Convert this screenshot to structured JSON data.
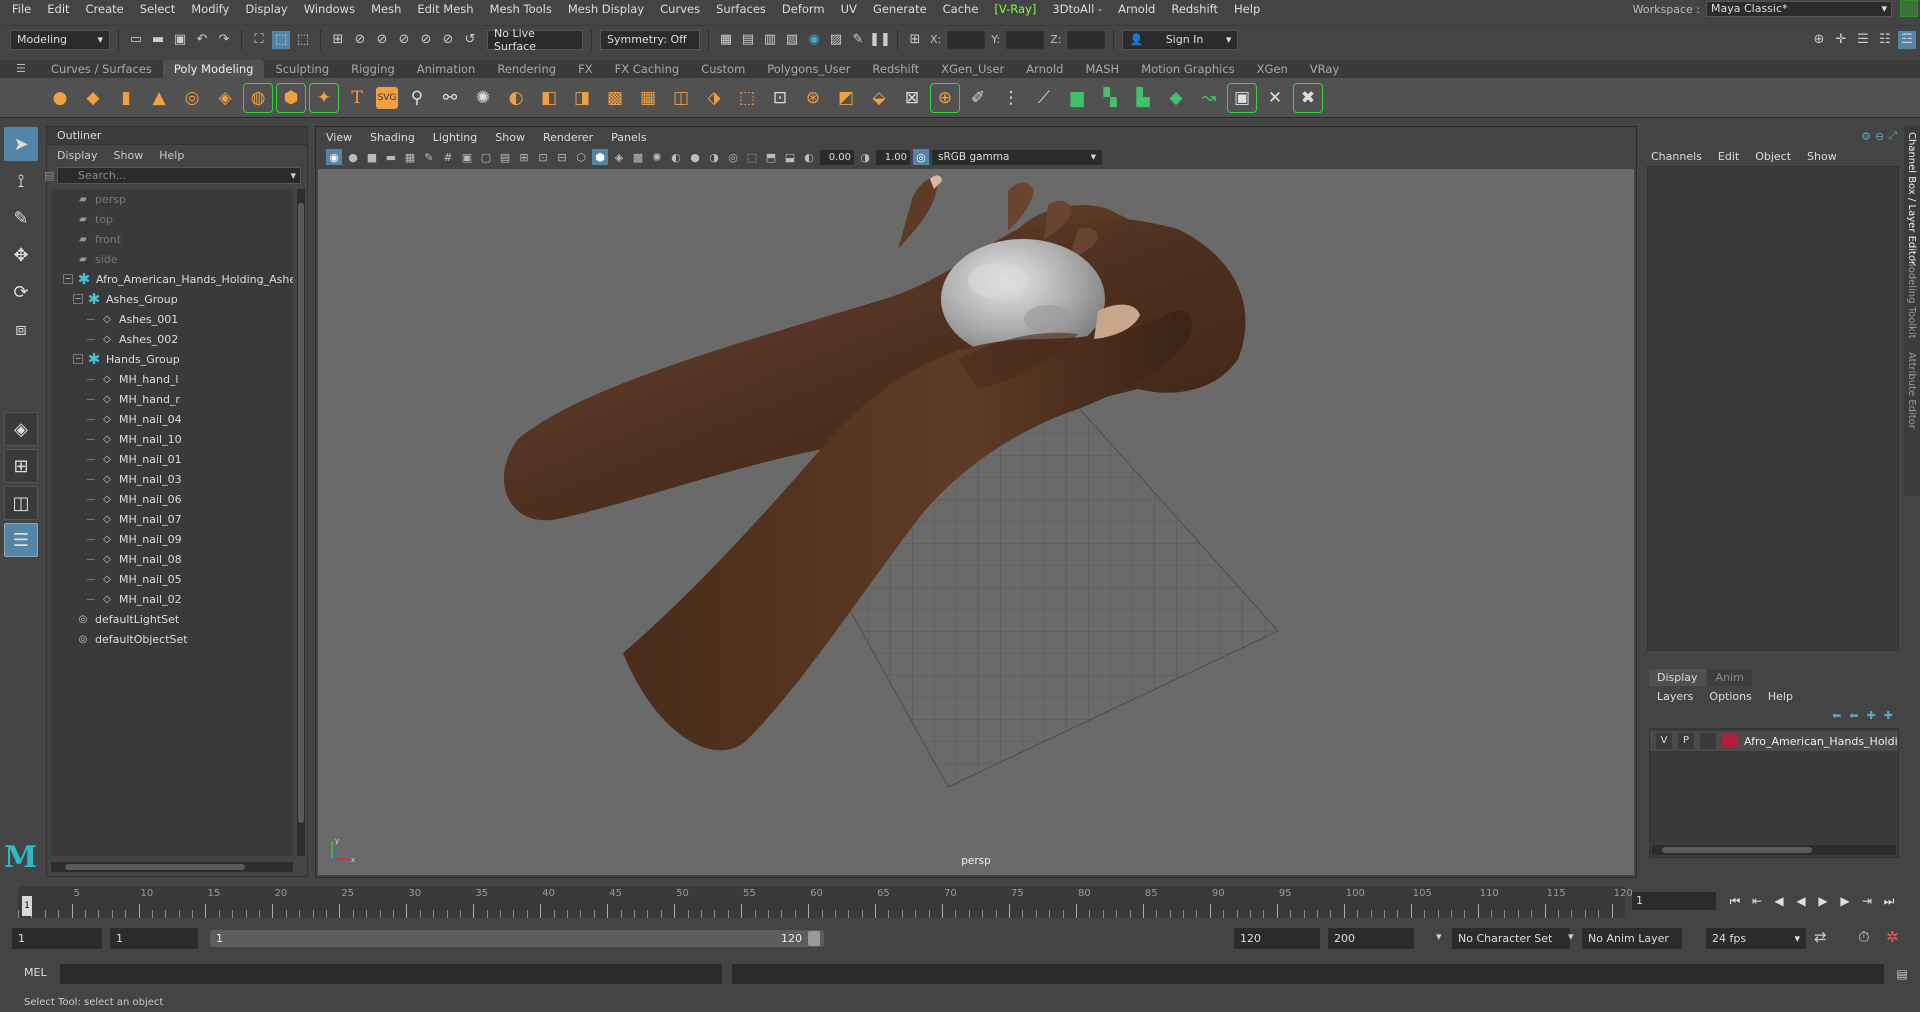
{
  "menubar": {
    "items": [
      "File",
      "Edit",
      "Create",
      "Select",
      "Modify",
      "Display",
      "Windows",
      "Mesh",
      "Edit Mesh",
      "Mesh Tools",
      "Mesh Display",
      "Curves",
      "Surfaces",
      "Deform",
      "UV",
      "Generate",
      "Cache",
      "[V-Ray]",
      "3DtoAll -",
      "Arnold",
      "Redshift",
      "Help"
    ],
    "workspace_label": "Workspace :",
    "workspace_value": "Maya Classic*"
  },
  "statusline": {
    "mode": "Modeling",
    "live_surface": "No Live Surface",
    "symmetry": "Symmetry: Off",
    "x_label": "X:",
    "y_label": "Y:",
    "z_label": "Z:",
    "sign_in": "Sign In"
  },
  "shelf": {
    "tabs": [
      "Curves / Surfaces",
      "Poly Modeling",
      "Sculpting",
      "Rigging",
      "Animation",
      "Rendering",
      "FX",
      "FX Caching",
      "Custom",
      "Polygons_User",
      "Redshift",
      "XGen_User",
      "Arnold",
      "MASH",
      "Motion Graphics",
      "XGen",
      "VRay"
    ],
    "active_tab": "Poly Modeling",
    "type_tool": "T",
    "svg_tool": "SVG"
  },
  "outliner": {
    "title": "Outliner",
    "menu": [
      "Display",
      "Show",
      "Help"
    ],
    "search_placeholder": "Search...",
    "items": [
      {
        "name": "persp",
        "kind": "camera",
        "depth": 0,
        "dim": true
      },
      {
        "name": "top",
        "kind": "camera",
        "depth": 0,
        "dim": true
      },
      {
        "name": "front",
        "kind": "camera",
        "depth": 0,
        "dim": true
      },
      {
        "name": "side",
        "kind": "camera",
        "depth": 0,
        "dim": true
      },
      {
        "name": "Afro_American_Hands_Holding_Ashe",
        "kind": "group",
        "depth": 0,
        "expander": "-"
      },
      {
        "name": "Ashes_Group",
        "kind": "group",
        "depth": 1,
        "expander": "-"
      },
      {
        "name": "Ashes_001",
        "kind": "mesh",
        "depth": 2
      },
      {
        "name": "Ashes_002",
        "kind": "mesh",
        "depth": 2
      },
      {
        "name": "Hands_Group",
        "kind": "group",
        "depth": 1,
        "expander": "-"
      },
      {
        "name": "MH_hand_l",
        "kind": "mesh",
        "depth": 2
      },
      {
        "name": "MH_hand_r",
        "kind": "mesh",
        "depth": 2
      },
      {
        "name": "MH_nail_04",
        "kind": "mesh",
        "depth": 2
      },
      {
        "name": "MH_nail_10",
        "kind": "mesh",
        "depth": 2
      },
      {
        "name": "MH_nail_01",
        "kind": "mesh",
        "depth": 2
      },
      {
        "name": "MH_nail_03",
        "kind": "mesh",
        "depth": 2
      },
      {
        "name": "MH_nail_06",
        "kind": "mesh",
        "depth": 2
      },
      {
        "name": "MH_nail_07",
        "kind": "mesh",
        "depth": 2
      },
      {
        "name": "MH_nail_09",
        "kind": "mesh",
        "depth": 2
      },
      {
        "name": "MH_nail_08",
        "kind": "mesh",
        "depth": 2
      },
      {
        "name": "MH_nail_05",
        "kind": "mesh",
        "depth": 2
      },
      {
        "name": "MH_nail_02",
        "kind": "mesh",
        "depth": 2
      },
      {
        "name": "defaultLightSet",
        "kind": "set",
        "depth": 0
      },
      {
        "name": "defaultObjectSet",
        "kind": "set",
        "depth": 0
      }
    ]
  },
  "viewport": {
    "menu": [
      "View",
      "Shading",
      "Lighting",
      "Show",
      "Renderer",
      "Panels"
    ],
    "exposure": "0.00",
    "gamma": "1.00",
    "color_space": "sRGB gamma",
    "camera": "persp",
    "axis_y": "y",
    "axis_x": "x"
  },
  "channelbox": {
    "menu": [
      "Channels",
      "Edit",
      "Object",
      "Show"
    ],
    "layer_tabs": [
      "Display",
      "Anim"
    ],
    "layer_menu": [
      "Layers",
      "Options",
      "Help"
    ],
    "layer": {
      "visible": "V",
      "playback": "P",
      "name": "Afro_American_Hands_Holding"
    },
    "side_tabs": [
      "Channel Box / Layer Editor",
      "Modeling Toolkit",
      "Attribute Editor"
    ]
  },
  "timeline": {
    "labels": [
      "5",
      "10",
      "15",
      "20",
      "25",
      "30",
      "35",
      "40",
      "45",
      "50",
      "55",
      "60",
      "65",
      "70",
      "75",
      "80",
      "85",
      "90",
      "95",
      "100",
      "105",
      "110",
      "115",
      "120"
    ],
    "current_frame": "1",
    "current_frame_field": "1"
  },
  "range": {
    "start": "1",
    "playback_start": "1",
    "slider_start": "1",
    "slider_end": "120",
    "playback_end": "120",
    "end": "200",
    "character_set": "No Character Set",
    "anim_layer": "No Anim Layer",
    "fps": "24 fps"
  },
  "cmdline": {
    "label": "MEL"
  },
  "helpline": {
    "text": "Select Tool: select an object"
  },
  "colors": {
    "accent": "#5285a6",
    "vray_green": "#7cff3c",
    "layer_color": "#b0203a",
    "skin": "#5a3a24"
  }
}
